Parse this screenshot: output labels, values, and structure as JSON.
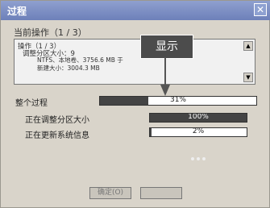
{
  "window": {
    "title": "过程",
    "close_glyph": "✕"
  },
  "current_operation": {
    "label": "当前操作（1 / 3）",
    "lines": [
      "操作（1 / 3）",
      "调整分区大小：9",
      "NTFS、本地卷、3756.6 MB 于",
      "新建大小：3004.3 MB"
    ]
  },
  "callout": {
    "text": "显示"
  },
  "progress": {
    "overall": {
      "label": "整个过程",
      "value": 31,
      "text": "31%"
    },
    "resize": {
      "label": "正在调整分区大小",
      "value": 100,
      "text": "100%"
    },
    "update": {
      "label": "正在更新系统信息",
      "value": 2,
      "text": "2%"
    }
  },
  "buttons": {
    "ok": "确定(O)"
  },
  "icons": {
    "scroll_up": "▲",
    "scroll_down": "▼"
  }
}
